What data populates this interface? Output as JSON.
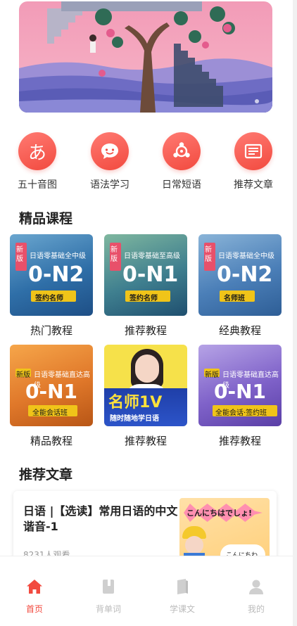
{
  "quick_nav": [
    {
      "label": "五十音图",
      "icon": "hiragana-a-icon",
      "glyph": "あ"
    },
    {
      "label": "语法学习",
      "icon": "chat-bubble-icon"
    },
    {
      "label": "日常短语",
      "icon": "phrase-dots-icon"
    },
    {
      "label": "推荐文章",
      "icon": "article-doc-icon"
    }
  ],
  "sections": {
    "courses_title": "精品课程",
    "articles_title": "推荐文章"
  },
  "courses": [
    {
      "label": "热门教程",
      "badge": "新版",
      "subtitle": "日语零基础全中级",
      "big": "0-N2",
      "tag": "签约名师"
    },
    {
      "label": "推荐教程",
      "badge": "新版",
      "subtitle": "日语零基础至高级",
      "big": "0-N1",
      "tag": "签约名师"
    },
    {
      "label": "经典教程",
      "badge": "新版",
      "subtitle": "日语零基础全中级",
      "big": "0-N2",
      "tag": "名师班"
    },
    {
      "label": "精品教程",
      "badge": "新版",
      "subtitle": "日语零基础直达高级",
      "big": "0-N1",
      "tag": "全能会话班"
    },
    {
      "label": "推荐教程",
      "big": "名师1V",
      "tag": "随时随地学日语"
    },
    {
      "label": "推荐教程",
      "badge": "新版",
      "subtitle": "日语零基础直达高级",
      "big": "0-N1",
      "tag": "全能会话·签约班"
    }
  ],
  "article": {
    "title": "日语 |【选读】常用日语的中文谐音-1",
    "views": "8231人观看",
    "thumb_text": "こんにちはでしょ!",
    "thumb_text2": "こんにちわ"
  },
  "tabs": [
    {
      "label": "首页",
      "icon": "home-icon",
      "active": true
    },
    {
      "label": "背单词",
      "icon": "book-icon",
      "active": false
    },
    {
      "label": "学课文",
      "icon": "textbook-icon",
      "active": false
    },
    {
      "label": "我的",
      "icon": "user-icon",
      "active": false
    }
  ],
  "colors": {
    "accent": "#f24a3f",
    "tab_inactive": "#bbbbbb"
  }
}
